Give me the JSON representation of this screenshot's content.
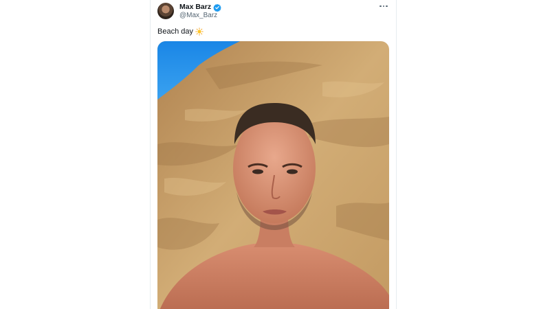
{
  "tweet": {
    "author": {
      "display_name": "Max Barz",
      "handle": "@Max_Barz",
      "verified": true
    },
    "text": "Beach day",
    "emoji": "sun-icon",
    "media": {
      "type": "photo"
    },
    "menu_icon": "more-icon"
  },
  "colors": {
    "verified_badge": "#1d9bf0",
    "sky": "#1e8de8",
    "sand": "#c9a46d",
    "text_primary": "#0f1419",
    "text_secondary": "#536471"
  }
}
